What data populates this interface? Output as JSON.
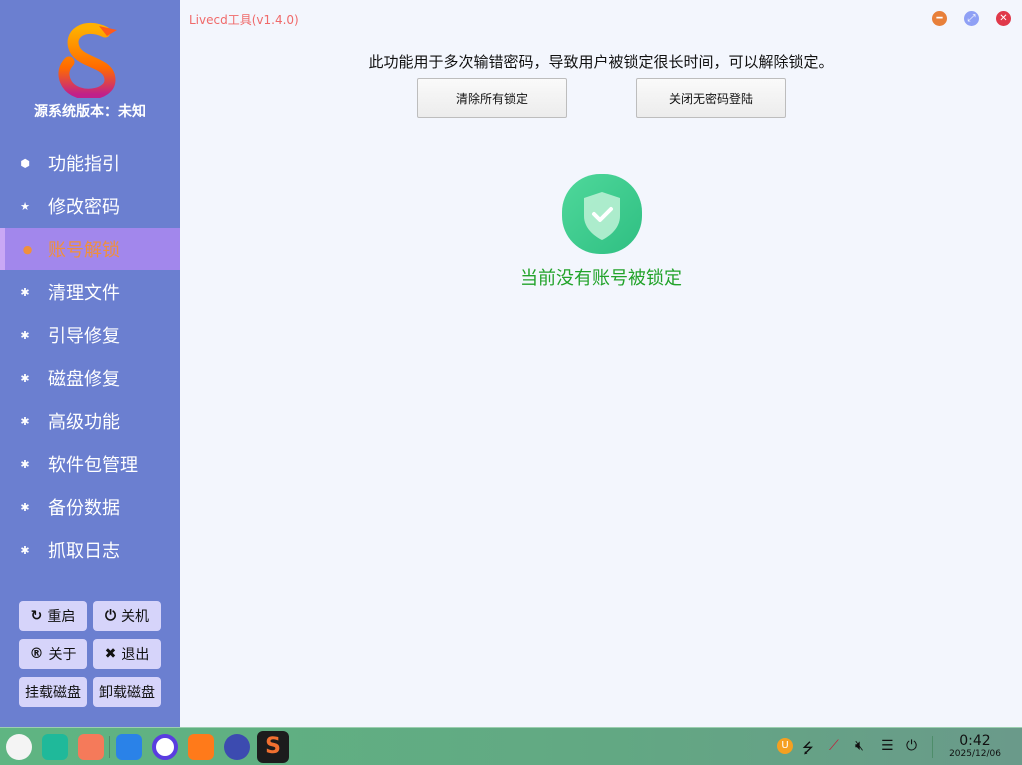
{
  "app": {
    "title": "Livecd工具(v1.4.0)"
  },
  "sidebar": {
    "version_label": "源系统版本：未知",
    "items": [
      {
        "label": "功能指引",
        "icon": "cube-icon"
      },
      {
        "label": "修改密码",
        "icon": "star-icon"
      },
      {
        "label": "账号解锁",
        "icon": "lock-icon",
        "selected": true
      },
      {
        "label": "清理文件",
        "icon": "bug-icon"
      },
      {
        "label": "引导修复",
        "icon": "bug-icon"
      },
      {
        "label": "磁盘修复",
        "icon": "bug-icon"
      },
      {
        "label": "高级功能",
        "icon": "bug-icon"
      },
      {
        "label": "软件包管理",
        "icon": "bug-icon"
      },
      {
        "label": "备份数据",
        "icon": "bug-icon"
      },
      {
        "label": "抓取日志",
        "icon": "bug-icon"
      }
    ],
    "buttons": {
      "reboot": "重启",
      "shutdown": "关机",
      "about": "关于",
      "exit": "退出",
      "mount": "挂载磁盘",
      "unmount": "卸载磁盘"
    }
  },
  "main": {
    "description": "此功能用于多次输错密码，导致用户被锁定很长时间，可以解除锁定。",
    "clear_locks": "清除所有锁定",
    "disable_passwordless": "关闭无密码登陆",
    "status": "当前没有账号被锁定"
  },
  "taskbar": {
    "time": "0:42",
    "date": "2025/12/06"
  },
  "colors": {
    "sidebar": "#6b7fd0",
    "selected": "#a287ec",
    "selected_text": "#f0903c",
    "status": "#22a32a"
  }
}
